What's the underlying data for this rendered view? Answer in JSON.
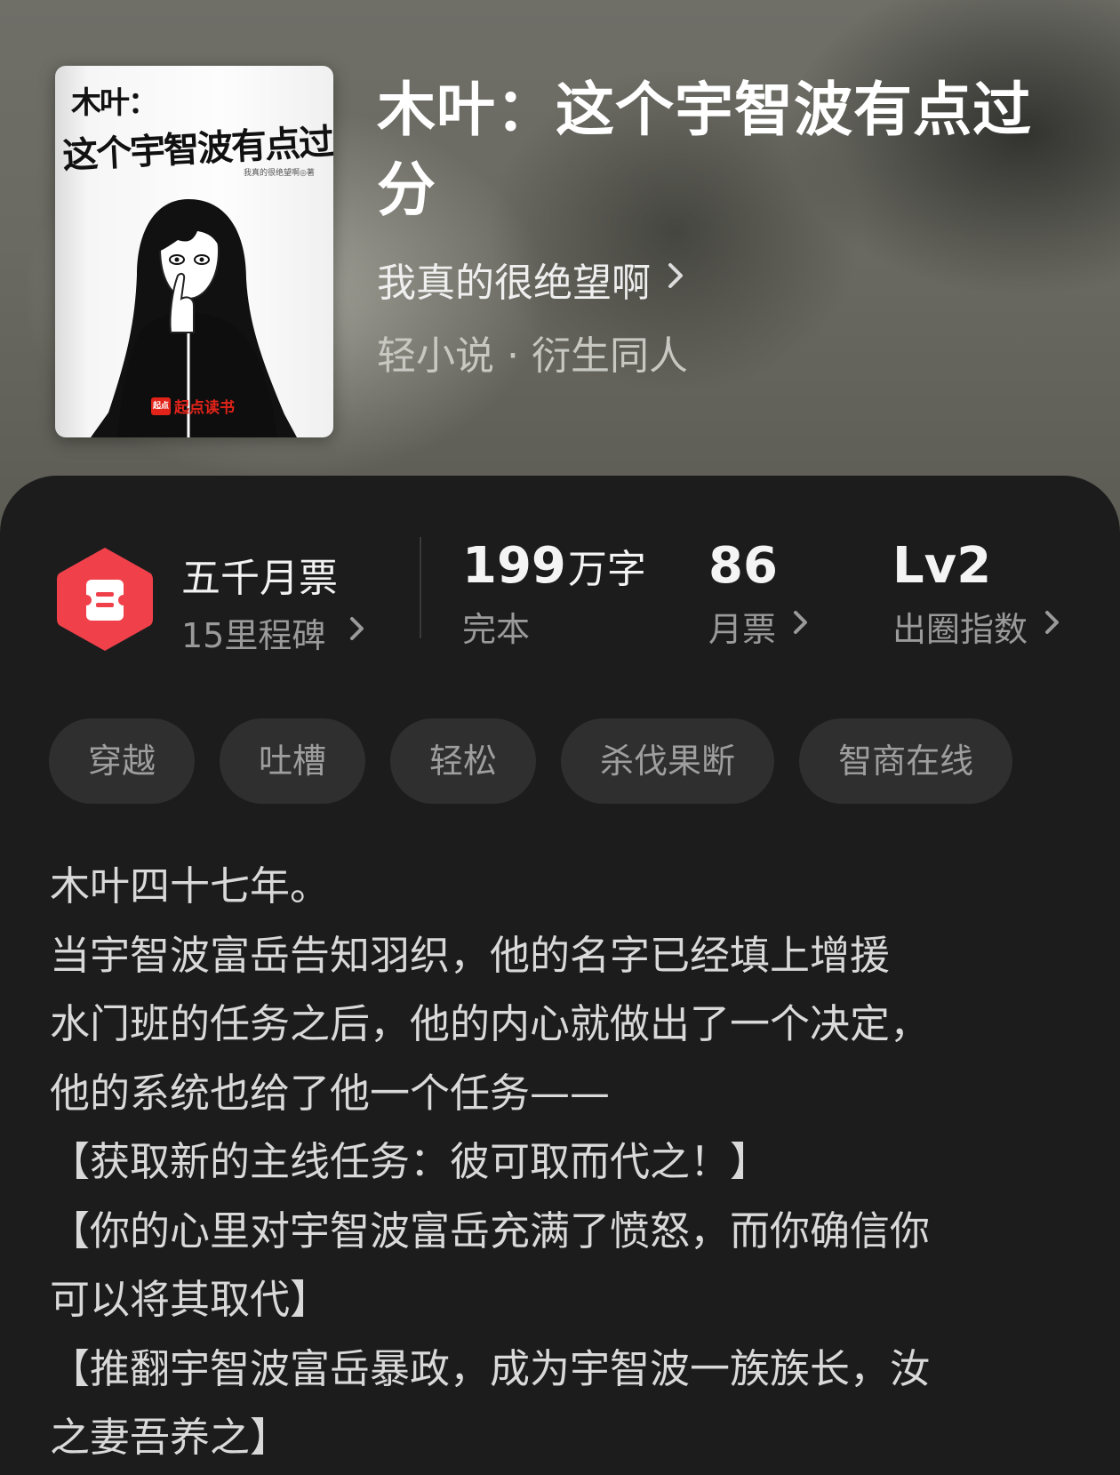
{
  "book": {
    "title": "木叶：这个宇智波有点过分",
    "author": "我真的很绝望啊",
    "genre": "轻小说 · 衍生同人",
    "cover": {
      "title_line1": "木叶：",
      "title_line2": "这个宇智波有点过分",
      "author_small": "我真的很绝望啊◎著",
      "publisher_mark": "起点",
      "publisher": "起点读书"
    }
  },
  "badge": {
    "title": "五千月票",
    "subtitle": "15里程碑",
    "color": "#f0414b"
  },
  "stats": {
    "word_count_number": "199",
    "word_count_unit": "万字",
    "word_count_label": "完本",
    "monthly_votes_value": "86",
    "monthly_votes_label": "月票",
    "level_value": "Lv2",
    "level_label": "出圈指数"
  },
  "tags": [
    "穿越",
    "吐槽",
    "轻松",
    "杀伐果断",
    "智商在线"
  ],
  "description": [
    "木叶四十七年。",
    "当宇智波富岳告知羽织，他的名字已经填上增援",
    "水门班的任务之后，他的内心就做出了一个决定，",
    "他的系统也给了他一个任务——",
    "【获取新的主线任务：彼可取而代之！】",
    "【你的心里对宇智波富岳充满了愤怒，而你确信你",
    "可以将其取代】",
    "【推翻宇智波富岳暴政，成为宇智波一族族长，汝",
    "之妻吾养之】"
  ]
}
